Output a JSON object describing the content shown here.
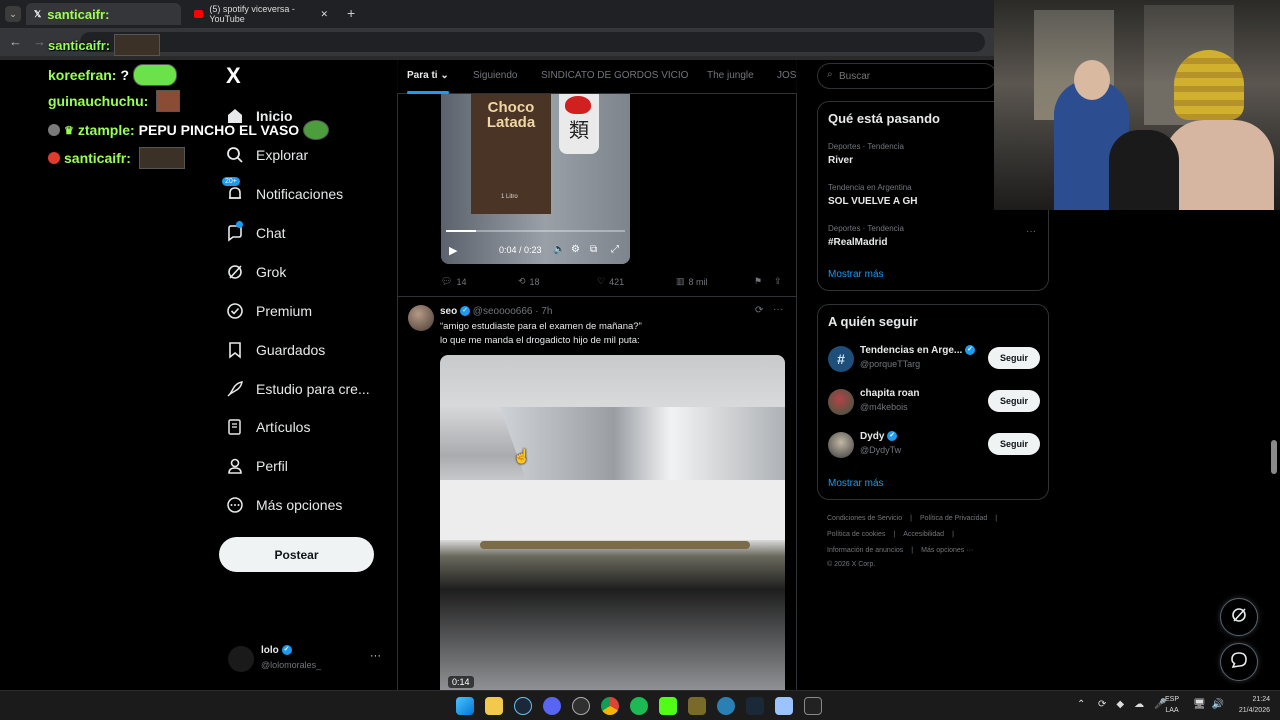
{
  "browser": {
    "tabs": [
      {
        "label": "santicaifr:"
      },
      {
        "label": "(5) spotify viceversa - YouTube"
      }
    ],
    "new_tab": "+",
    "address_user": "santicaifr:"
  },
  "chat": [
    {
      "user": "koreefran:",
      "message": "?"
    },
    {
      "user": "guinauchuchu:",
      "message": ""
    },
    {
      "user": "ztample:",
      "message": "PEPU PINCHO EL VASO"
    },
    {
      "user": "santicaifr:",
      "message": ""
    }
  ],
  "nav": {
    "logo": "X",
    "items": [
      {
        "label": "Inicio"
      },
      {
        "label": "Explorar"
      },
      {
        "label": "Notificaciones",
        "badge": "20+"
      },
      {
        "label": "Chat"
      },
      {
        "label": "Grok"
      },
      {
        "label": "Premium"
      },
      {
        "label": "Guardados"
      },
      {
        "label": "Estudio para cre..."
      },
      {
        "label": "Artículos"
      },
      {
        "label": "Perfil"
      },
      {
        "label": "Más opciones"
      }
    ],
    "post_button": "Postear",
    "account": {
      "name": "lolo",
      "handle": "@lolomorales_"
    }
  },
  "feed": {
    "tabs": [
      "Para ti",
      "Siguiendo",
      "SINDICATO DE GORDOS VICIO",
      "The jungle",
      "JOS"
    ],
    "tweet1": {
      "video_time": "0:04 / 0:23",
      "carton_text": "Choco Latada",
      "carton_volume": "1 Litro",
      "cup_text": "類",
      "replies": "14",
      "retweets": "18",
      "likes": "421",
      "views": "8 mil"
    },
    "tweet2": {
      "name": "seo",
      "handle": "@seoooo666",
      "time": "· 7h",
      "text_line1": "“amigo estudiaste para el examen de mañana?”",
      "text_line2": "lo que me manda el drogadicto hijo de mil puta:",
      "video_time": "0:14"
    }
  },
  "sidebar": {
    "search_placeholder": "Buscar",
    "trends_title": "Qué está pasando",
    "trends": [
      {
        "meta": "Deportes · Tendencia",
        "name": "River"
      },
      {
        "meta": "Tendencia en Argentina",
        "name": "SOL VUELVE A GH"
      },
      {
        "meta": "Deportes · Tendencia",
        "name": "#RealMadrid"
      }
    ],
    "show_more": "Mostrar más",
    "follow_title": "A quién seguir",
    "follow": [
      {
        "name": "Tendencias en Arge...",
        "handle": "@porqueTTarg",
        "button": "Seguir"
      },
      {
        "name": "chapita roan",
        "handle": "@m4kebois",
        "button": "Seguir"
      },
      {
        "name": "Dydy",
        "handle": "@DydyTw",
        "button": "Seguir"
      }
    ],
    "show_more_2": "Mostrar más",
    "footer": [
      "Condiciones de Servicio",
      "|",
      "Política de Privacidad",
      "|",
      "Política de cookies",
      "|",
      "Accesibilidad",
      "|",
      "Información de anuncios",
      "|",
      "Más opciones ···",
      "© 2026 X Corp."
    ]
  },
  "taskbar": {
    "lang": "ESP",
    "lang2": "LAA",
    "time": "21:24",
    "date": "21/4/2026"
  },
  "colors": {
    "accent": "#1d9bf0",
    "chat_user": "#9aff55",
    "background": "#000000"
  }
}
